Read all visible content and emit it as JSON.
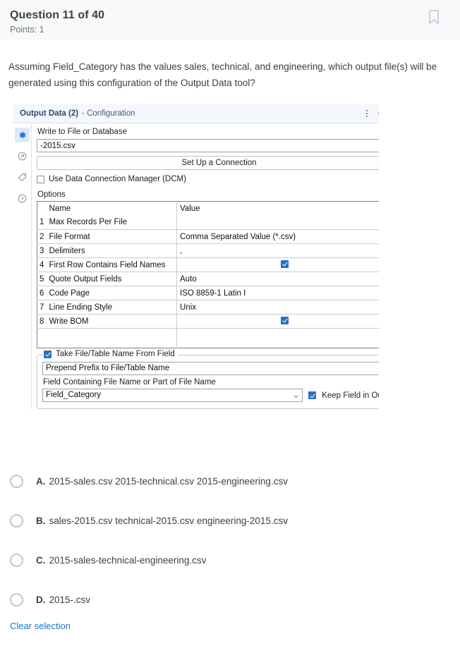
{
  "header": {
    "title": "Question 11 of 40",
    "points": "Points: 1",
    "bookmark_icon": "bookmark-icon"
  },
  "question": {
    "stem": "Assuming Field_Category has the values sales, technical, and engineering, which output file(s) will be generated using this configuration of the Output Data tool?"
  },
  "config_panel": {
    "title": "Output Data (2)",
    "title_suffix": "- Configuration",
    "menu_icon": "kebab-menu-icon",
    "pin_icon": "pin-icon",
    "rail_icons": [
      "gear-icon",
      "arrow-in-circle-icon",
      "tag-icon",
      "question-mark-icon"
    ],
    "write_label": "Write to File or Database",
    "file_path": "-2015.csv",
    "connection_button": "Set Up a Connection",
    "dcm_label": "Use Data Connection Manager (DCM)",
    "dcm_checked": false,
    "options_title": "Options",
    "table": {
      "columns": [
        "Name",
        "Value"
      ],
      "rows": [
        {
          "num": "1",
          "name": "Max Records Per File",
          "value": "",
          "type": "text"
        },
        {
          "num": "2",
          "name": "File Format",
          "value": "Comma Separated Value (*.csv)",
          "type": "select"
        },
        {
          "num": "3",
          "name": "Delimiters",
          "value": ",",
          "type": "text"
        },
        {
          "num": "4",
          "name": "First Row Contains Field Names",
          "value": "",
          "type": "checkbox",
          "checked": true
        },
        {
          "num": "5",
          "name": "Quote Output Fields",
          "value": "Auto",
          "type": "select"
        },
        {
          "num": "6",
          "name": "Code Page",
          "value": "ISO 8859-1 Latin I",
          "type": "select"
        },
        {
          "num": "7",
          "name": "Line Ending Style",
          "value": "Unix",
          "type": "select"
        },
        {
          "num": "8",
          "name": "Write BOM",
          "value": "",
          "type": "checkbox",
          "checked": true
        }
      ]
    },
    "take_name_label": "Take File/Table Name From Field",
    "take_name_checked": true,
    "prefix_mode": "Prepend Prefix to File/Table Name",
    "field_label": "Field Containing File Name or Part of File Name",
    "field_value": "Field_Category",
    "keep_field_label": "Keep Field in Output",
    "keep_field_checked": true
  },
  "answers": {
    "options": [
      {
        "letter": "A.",
        "text": "2015-sales.csv 2015-technical.csv 2015-engineering.csv",
        "selected": false
      },
      {
        "letter": "B.",
        "text": "sales-2015.csv technical-2015.csv engineering-2015.csv",
        "selected": false
      },
      {
        "letter": "C.",
        "text": "2015-sales-technical-engineering.csv",
        "selected": false
      },
      {
        "letter": "D.",
        "text": "2015-.csv",
        "selected": false
      }
    ],
    "clear_label": "Clear selection"
  },
  "colors": {
    "accent_blue": "#2a6fc9",
    "link_blue": "#1a73c7",
    "header_bg": "#f7f9fa",
    "panel_title": "#2c4a72"
  }
}
